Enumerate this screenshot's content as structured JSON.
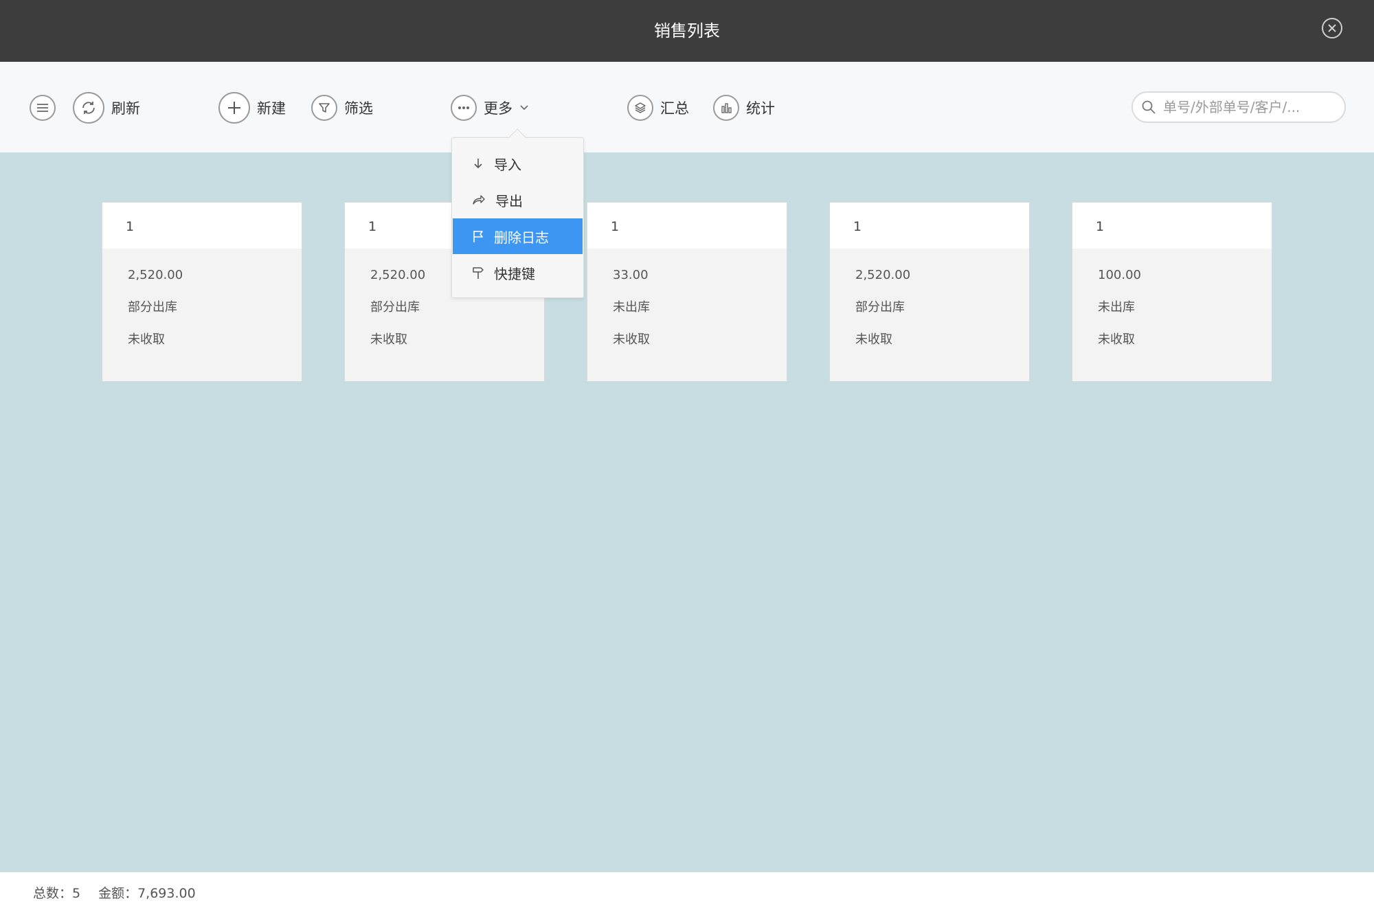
{
  "window": {
    "title": "销售列表"
  },
  "toolbar": {
    "refresh_label": "刷新",
    "new_label": "新建",
    "filter_label": "筛选",
    "more_label": "更多",
    "summary_label": "汇总",
    "stats_label": "统计"
  },
  "search": {
    "placeholder": "单号/外部单号/客户/..."
  },
  "more_menu": {
    "items": [
      {
        "label": "导入",
        "icon": "arrow-down-icon"
      },
      {
        "label": "导出",
        "icon": "share-icon"
      },
      {
        "label": "删除日志",
        "icon": "flag-icon",
        "active": true
      },
      {
        "label": "快捷键",
        "icon": "signpost-icon"
      }
    ]
  },
  "cards": [
    {
      "header": "1",
      "amount": "2,520.00",
      "stock_status": "部分出库",
      "payment_status": "未收取"
    },
    {
      "header": "1",
      "amount": "2,520.00",
      "stock_status": "部分出库",
      "payment_status": "未收取"
    },
    {
      "header": "1",
      "amount": "33.00",
      "stock_status": "未出库",
      "payment_status": "未收取"
    },
    {
      "header": "1",
      "amount": "2,520.00",
      "stock_status": "部分出库",
      "payment_status": "未收取"
    },
    {
      "header": "1",
      "amount": "100.00",
      "stock_status": "未出库",
      "payment_status": "未收取"
    }
  ],
  "footer": {
    "total_text": "总数：5",
    "amount_text": "金额：7,693.00"
  },
  "colors": {
    "titlebar": "#3d3d3d",
    "background": "#c8dde1",
    "accent": "#3d96f2"
  }
}
